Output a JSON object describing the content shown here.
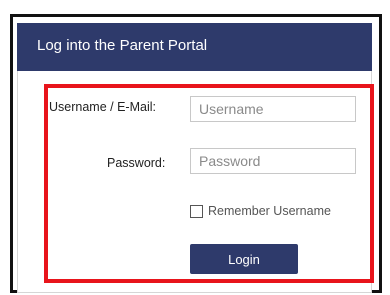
{
  "header": {
    "title": "Log into the Parent Portal"
  },
  "form": {
    "username": {
      "label": "Username / E-Mail:",
      "placeholder": "Username",
      "value": ""
    },
    "password": {
      "label": "Password:",
      "placeholder": "Password",
      "value": ""
    },
    "remember": {
      "label": "Remember Username",
      "checked": false
    },
    "login_label": "Login"
  },
  "colors": {
    "header_bg": "#2e3a6b",
    "button_bg": "#2e3a6b",
    "highlight_border": "#e8141b",
    "frame_border": "#111111"
  }
}
